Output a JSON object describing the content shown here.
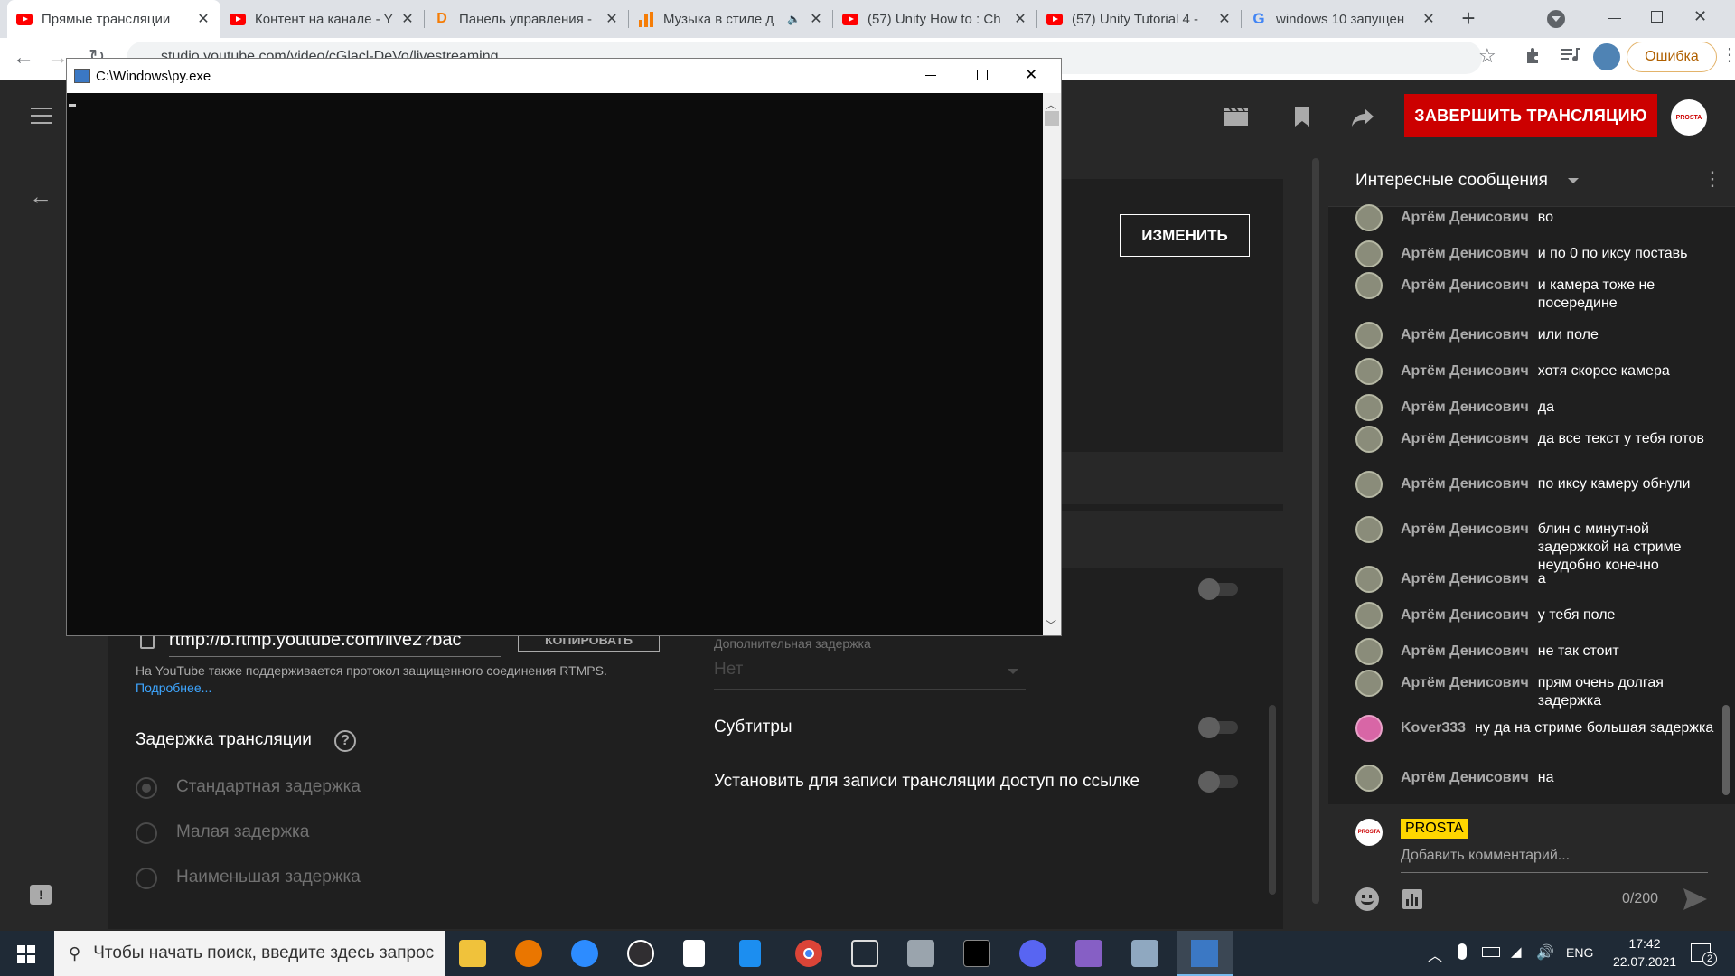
{
  "browser": {
    "tabs": [
      {
        "title": "Прямые трансляции",
        "favicon": "youtube-icon",
        "active": true
      },
      {
        "title": "Контент на канале - Y",
        "favicon": "youtube-icon"
      },
      {
        "title": "Панель управления -",
        "favicon": "donationalerts-icon"
      },
      {
        "title": "Музыка в стиле д",
        "favicon": "bars-icon",
        "muted_icon": "speaker-icon"
      },
      {
        "title": "(57) Unity How to : Ch",
        "favicon": "youtube-icon"
      },
      {
        "title": "(57) Unity Tutorial 4 -",
        "favicon": "youtube-icon"
      },
      {
        "title": "windows 10 запущен",
        "favicon": "google-icon"
      }
    ],
    "new_tab": "+",
    "url": "studio.youtube.com/video/cGlacl-DeVo/livestreaming",
    "profile_error": "Ошибка"
  },
  "header": {
    "end_stream_label": "ЗАВЕРШИТЬ ТРАНСЛЯЦИЮ",
    "avatar_text": "PROSTA"
  },
  "settings": {
    "change_label": "ИЗМЕНИТЬ",
    "stream_url": "rtmp://b.rtmp.youtube.com/live2?bac",
    "copy_label": "КОПИРОВАТЬ",
    "rtmps_note": "На YouTube также поддерживается протокол защищенного соединения RTMPS.",
    "more_link": "Подробнее...",
    "latency_title": "Задержка трансляции",
    "latency_options": [
      "Стандартная задержка",
      "Малая задержка",
      "Наименьшая задержка"
    ],
    "extra_delay_label": "Дополнительная задержка",
    "extra_delay_value": "Нет",
    "subtitles_label": "Субтитры",
    "unlisted_label": "Установить для записи трансляции доступ по ссылке"
  },
  "chat": {
    "title": "Интересные сообщения",
    "messages": [
      {
        "author": "Артём Денисович",
        "text": "во"
      },
      {
        "author": "Артём Денисович",
        "text": "и по 0 по иксу поставь"
      },
      {
        "author": "Артём Денисович",
        "text": "и камера тоже не посередине"
      },
      {
        "author": "Артём Денисович",
        "text": "или поле"
      },
      {
        "author": "Артём Денисович",
        "text": "хотя скорее камера"
      },
      {
        "author": "Артём Денисович",
        "text": "да"
      },
      {
        "author": "Артём Денисович",
        "text": "да все текст у тебя готов"
      },
      {
        "author": "Артём Денисович",
        "text": "по иксу камеру обнули"
      },
      {
        "author": "Артём Денисович",
        "text": "блин с минутной задержкой на стриме неудобно конечно"
      },
      {
        "author": "Артём Денисович",
        "text": "а"
      },
      {
        "author": "Артём Денисович",
        "text": "у тебя поле"
      },
      {
        "author": "Артём Денисович",
        "text": "не так стоит"
      },
      {
        "author": "Артём Денисович",
        "text": "прям очень долгая задержка"
      },
      {
        "author": "Kover333",
        "text": "ну да на стриме большая задержка"
      },
      {
        "author": "Артём Денисович",
        "text": "на"
      }
    ],
    "input_user": "PROSTA",
    "input_placeholder": "Добавить комментарий...",
    "counter": "0/200"
  },
  "console": {
    "title": "C:\\Windows\\py.exe"
  },
  "taskbar": {
    "search_placeholder": "Чтобы начать поиск, введите здесь запрос",
    "lang": "ENG",
    "time": "17:42",
    "date": "22.07.2021",
    "notif_count": "2"
  },
  "colors": {
    "yt_red": "#cc0000",
    "bg_dark": "#282828",
    "panel": "#1f1f1f",
    "link": "#3ea6ff",
    "badge_yellow": "#ffd600"
  }
}
